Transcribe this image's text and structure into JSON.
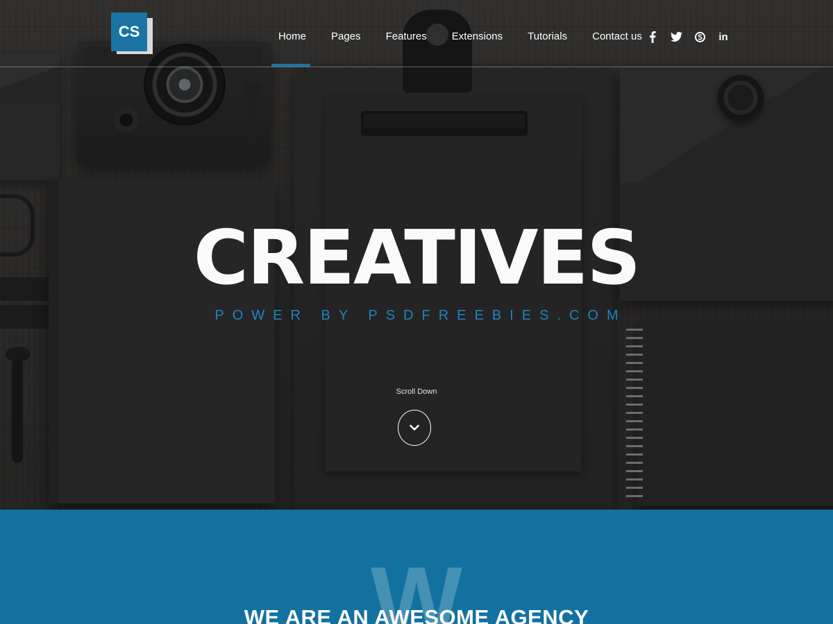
{
  "brand": {
    "logo_text": "CS"
  },
  "nav": {
    "items": [
      {
        "label": "Home",
        "active": true
      },
      {
        "label": "Pages"
      },
      {
        "label": "Features"
      },
      {
        "label": "Extensions"
      },
      {
        "label": "Tutorials"
      },
      {
        "label": "Contact us"
      }
    ]
  },
  "social": {
    "icons": [
      "facebook-icon",
      "twitter-icon",
      "skype-icon",
      "linkedin-icon"
    ],
    "linkedin_text": "in"
  },
  "hero": {
    "title": "CREATIVES",
    "subtitle": "POWER BY PSDFREEBIES.COM",
    "scroll_label": "Scroll Down",
    "scroll_icon": "chevron-down-icon"
  },
  "about": {
    "watermark_letter": "W",
    "title": "WE ARE AN AWESOME AGENCY"
  },
  "colors": {
    "accent": "#1a74a3",
    "section_blue": "#13719f",
    "subtitle_blue": "#1b86c0"
  }
}
